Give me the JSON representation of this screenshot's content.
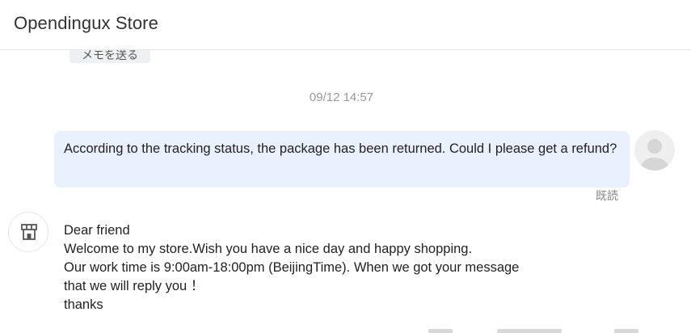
{
  "header": {
    "title": "Opendingux Store"
  },
  "chat": {
    "previous_button_label": "メモを送る",
    "timestamp": "09/12 14:57",
    "outgoing": {
      "text": "According to the tracking status, the package has been returned. Could I please get a refund?",
      "status": "既読"
    },
    "incoming": {
      "lines": [
        "Dear friend",
        "Welcome to my store.Wish you have a nice day and happy shopping.",
        "Our work time is 9:00am-18:00pm (BeijingTime). When we got your message",
        "that we will reply you ！",
        "thanks"
      ]
    }
  },
  "icons": {
    "user_avatar": "user-avatar-icon",
    "store_avatar": "store-icon"
  },
  "colors": {
    "outgoing_bubble": "#e8f1fd",
    "timestamp": "#999999",
    "read_status": "#888888"
  }
}
